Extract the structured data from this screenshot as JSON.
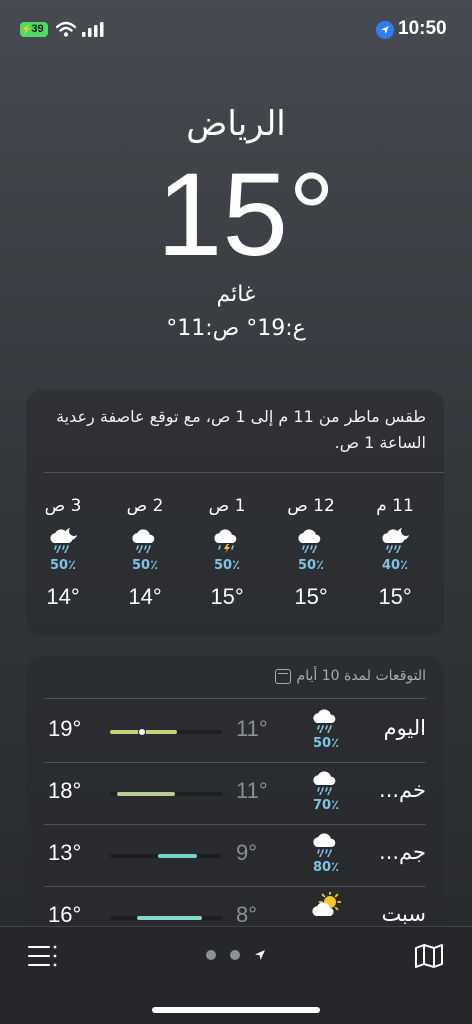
{
  "status_bar": {
    "battery": "39",
    "time": "10:50"
  },
  "header": {
    "city": "الرياض",
    "temperature": "15°",
    "condition": "غائم",
    "high_low": "ع:19°  ص:11°"
  },
  "hourly": {
    "summary": "طقس ماطر من 11 م إلى 1 ص، مع توقع عاصفة رعدية الساعة 1 ص.",
    "hours": [
      {
        "time": "11 م",
        "icon": "cloud-moon-rain-icon",
        "pop": "40٪",
        "temp": "15°"
      },
      {
        "time": "12 ص",
        "icon": "cloud-rain-icon",
        "pop": "50٪",
        "temp": "15°"
      },
      {
        "time": "1 ص",
        "icon": "cloud-bolt-rain-icon",
        "pop": "50٪",
        "temp": "15°"
      },
      {
        "time": "2 ص",
        "icon": "cloud-rain-icon",
        "pop": "50٪",
        "temp": "14°"
      },
      {
        "time": "3 ص",
        "icon": "cloud-moon-rain-icon",
        "pop": "50٪",
        "temp": "14°"
      }
    ]
  },
  "daily": {
    "header": "التوقعات لمدة 10 أيام",
    "days": [
      {
        "name": "اليوم",
        "icon": "cloud-rain-icon",
        "pop": "50٪",
        "low": "11°",
        "high": "19°",
        "range_start": 0.0,
        "range_end": 0.6,
        "current": 0.29,
        "bar_color": "#c8d07a"
      },
      {
        "name": "خم...",
        "icon": "cloud-rain-icon",
        "pop": "70٪",
        "low": "11°",
        "high": "18°",
        "range_start": 0.06,
        "range_end": 0.58,
        "current": null,
        "bar_color": "#b5cf8e"
      },
      {
        "name": "جم...",
        "icon": "cloud-rain-icon",
        "pop": "80٪",
        "low": "9°",
        "high": "13°",
        "range_start": 0.43,
        "range_end": 0.78,
        "current": null,
        "bar_color": "#7ecfd4"
      },
      {
        "name": "سبت",
        "icon": "sun-cloud-icon",
        "pop": "",
        "low": "8°",
        "high": "16°",
        "range_start": 0.24,
        "range_end": 0.82,
        "current": null,
        "bar_color": "#86d6d0"
      }
    ]
  },
  "toolbar": {
    "list_icon": "list-icon",
    "map_icon": "map-icon",
    "pages": 3
  }
}
